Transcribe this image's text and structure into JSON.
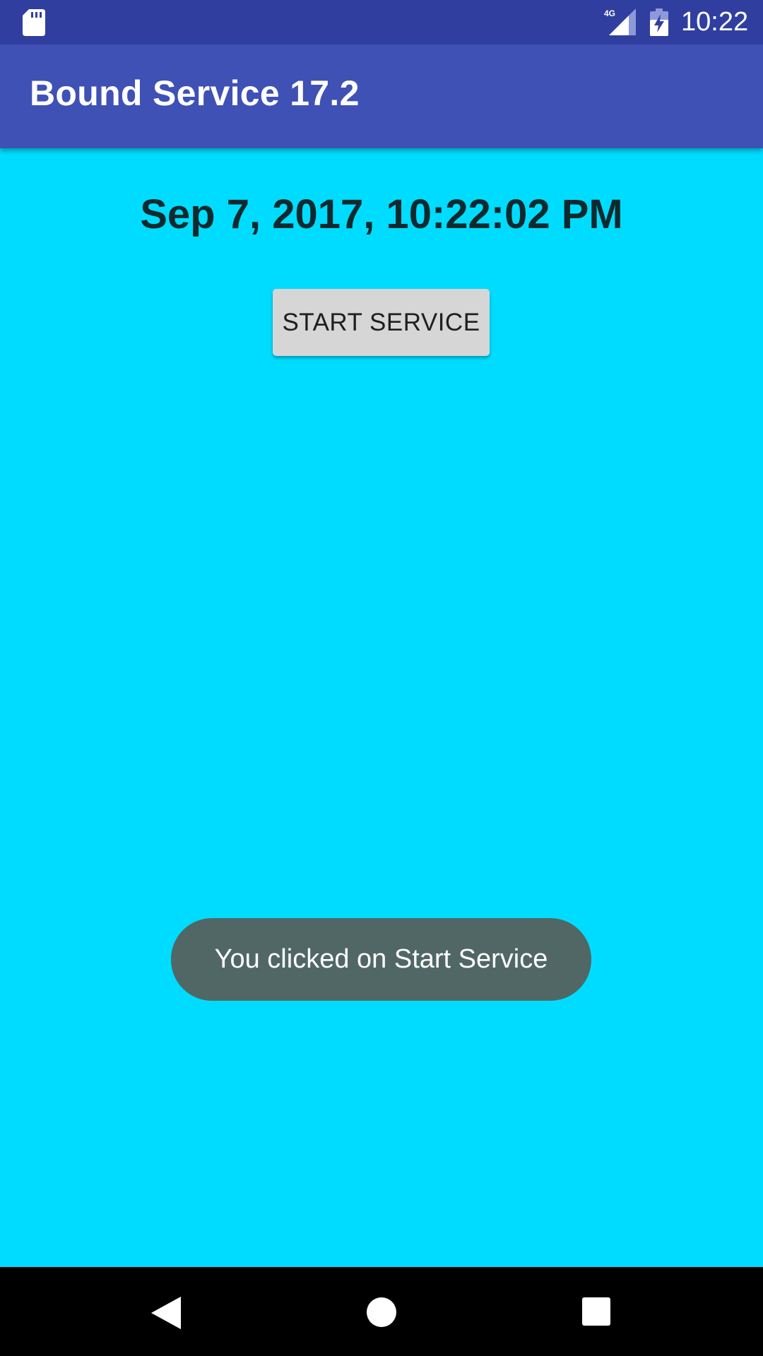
{
  "status_bar": {
    "network_label": "4G",
    "time": "10:22",
    "icons": [
      "sd-card-icon",
      "cellular-signal-icon",
      "battery-charging-icon"
    ]
  },
  "app_bar": {
    "title": "Bound Service 17.2"
  },
  "main": {
    "datetime": "Sep 7, 2017, 10:22:02 PM",
    "start_button_label": "START SERVICE"
  },
  "toast": {
    "message": "You clicked on Start Service"
  },
  "nav_bar": {
    "icons": [
      "back-icon",
      "home-icon",
      "recents-icon"
    ]
  },
  "colors": {
    "status_bar": "#303f9f",
    "app_bar": "#3f51b5",
    "background": "#00dcff",
    "toast": "#506766",
    "button": "#d6d6d6",
    "nav_bar": "#000000"
  }
}
